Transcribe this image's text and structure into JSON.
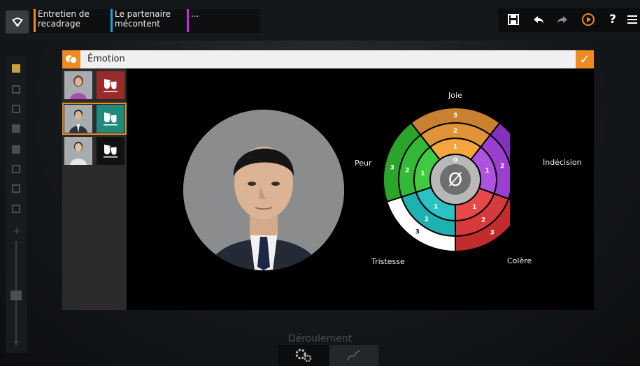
{
  "tabs": [
    {
      "line1": "Entretien de",
      "line2": "recadrage",
      "color": "#ef8a21"
    },
    {
      "line1": "Le partenaire",
      "line2": "mécontent",
      "color": "#1aa7e0"
    },
    {
      "line1": "",
      "line2": "...",
      "color": "#c22fd6"
    }
  ],
  "toolbar": {
    "save": "save-icon",
    "undo": "undo-icon",
    "redo": "redo-icon",
    "play": "play-icon",
    "help": "?",
    "menu": "menu-icon"
  },
  "dialog": {
    "title": "Émotion",
    "confirm": "✓"
  },
  "characters": [
    {
      "name": "female-character",
      "mask_color": "#9a2b2b"
    },
    {
      "name": "male-character",
      "mask_color": "#1f8a7c"
    },
    {
      "name": "female-character-2",
      "mask_color": "#111111"
    }
  ],
  "wheel": {
    "center": "0",
    "center_symbol": "Ø",
    "labels": {
      "joie": "Joie",
      "indecision": "Indécision",
      "colere": "Colère",
      "tristesse": "Tristesse",
      "peur": "Peur"
    },
    "levels": [
      "1",
      "2",
      "3"
    ],
    "colors": {
      "joie": [
        "#f2a63c",
        "#e0943a",
        "#c7812f"
      ],
      "indecision": [
        "#b052e0",
        "#9b3fd1",
        "#8530bf"
      ],
      "colere": [
        "#e84848",
        "#d63a3a",
        "#c22c2c"
      ],
      "tristesse": [
        "#2ac2c2",
        "#1fb0b0",
        "#ffffff"
      ],
      "peur": [
        "#3fcb3f",
        "#35b835",
        "#2aa52a"
      ]
    }
  },
  "bottom": {
    "title": "Déroulement"
  }
}
